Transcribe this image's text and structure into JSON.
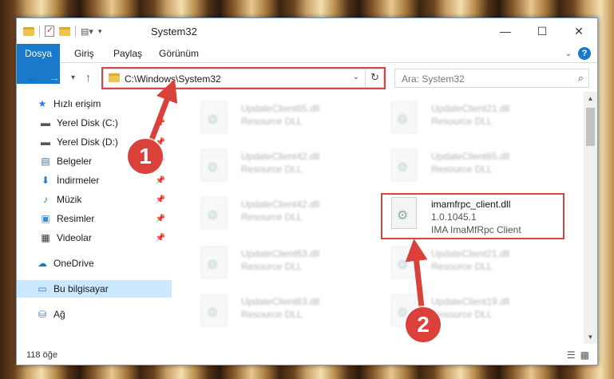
{
  "window": {
    "title": "System32",
    "controls": {
      "minimize": "—",
      "maximize": "☐",
      "close": "✕"
    }
  },
  "ribbon": {
    "tabs": [
      "Dosya",
      "Giriş",
      "Paylaş",
      "Görünüm"
    ],
    "help": "?"
  },
  "navbar": {
    "back": "←",
    "forward": "→",
    "recent": "▾",
    "up": "↑",
    "address": "C:\\Windows\\System32",
    "refresh": "↻",
    "search_placeholder": "Ara: System32"
  },
  "sidebar": {
    "items": [
      {
        "label": "Hızlı erişim",
        "icon": "star-icon"
      },
      {
        "label": "Yerel Disk (C:)",
        "icon": "drive-icon",
        "pinned": true
      },
      {
        "label": "Yerel Disk (D:)",
        "icon": "drive-icon",
        "pinned": true
      },
      {
        "label": "Belgeler",
        "icon": "documents-icon",
        "pinned": true
      },
      {
        "label": "İndirmeler",
        "icon": "download-icon",
        "pinned": true
      },
      {
        "label": "Müzik",
        "icon": "music-icon",
        "pinned": true
      },
      {
        "label": "Resimler",
        "icon": "pictures-icon",
        "pinned": true
      },
      {
        "label": "Videolar",
        "icon": "videos-icon",
        "pinned": true
      },
      {
        "label": "OneDrive",
        "icon": "cloud-icon"
      },
      {
        "label": "Bu bilgisayar",
        "icon": "computer-icon",
        "selected": true
      },
      {
        "label": "Ağ",
        "icon": "network-icon"
      }
    ]
  },
  "files": [
    {
      "name": "UpdateClient65.dll",
      "desc": "Resource DLL"
    },
    {
      "name": "UpdateClient21.dll",
      "desc": "Resource DLL"
    },
    {
      "name": "UpdateClient42.dll",
      "desc": "Resource DLL"
    },
    {
      "name": "UpdateClient65.dll",
      "desc": "Resource DLL"
    },
    {
      "name": "UpdateClient42.dll",
      "desc": "Resource DLL"
    },
    {
      "name": "imamfrpc_client.dll",
      "version": "1.0.1045.1",
      "desc": "IMA ImaMfRpc Client"
    },
    {
      "name": "UpdateClient63.dll",
      "desc": "Resource DLL"
    },
    {
      "name": "UpdateClient21.dll",
      "desc": "Resource DLL"
    },
    {
      "name": "UpdateClient63.dll",
      "desc": "Resource DLL"
    },
    {
      "name": "UpdateClient19.dll",
      "desc": "Resource DLL"
    }
  ],
  "status": {
    "count": "118 öğe"
  },
  "callouts": [
    "1",
    "2"
  ],
  "colors": {
    "accent": "#1979ca",
    "highlight": "#d64545",
    "callout": "#d9413a"
  }
}
